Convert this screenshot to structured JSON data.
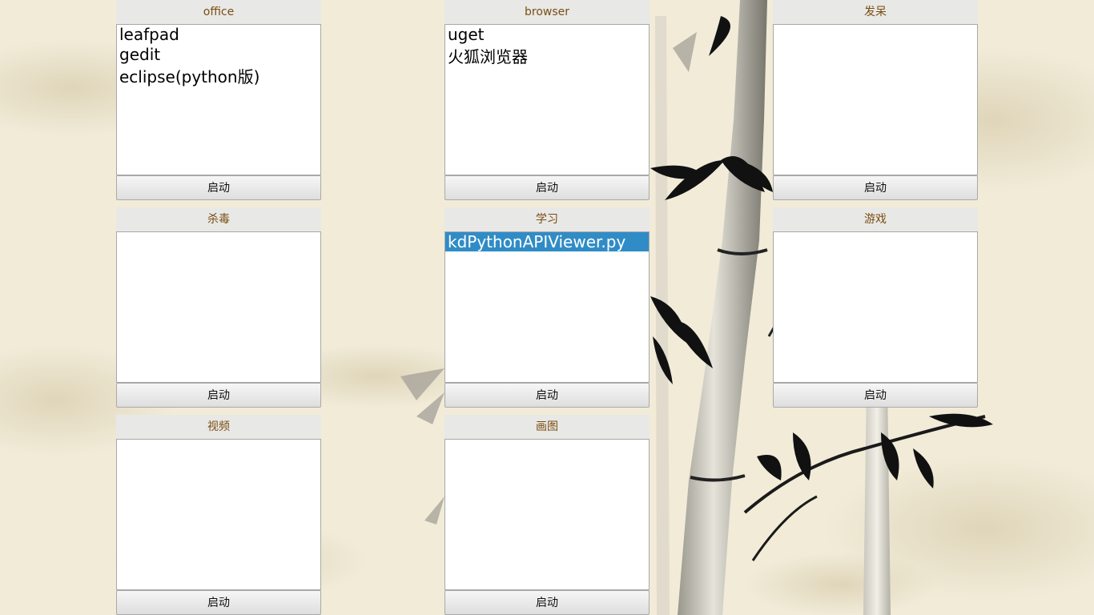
{
  "theme": {
    "background": "#f1ebd8",
    "header_text_color": "#7a4e10",
    "selection_color": "#308cc6"
  },
  "panels": [
    {
      "title": "office",
      "items": [
        "leafpad",
        "gedit",
        "eclipse(python版)"
      ],
      "selected_index": -1,
      "button_label": "启动"
    },
    {
      "title": "browser",
      "items": [
        "uget",
        "火狐浏览器"
      ],
      "selected_index": -1,
      "button_label": "启动"
    },
    {
      "title": "发呆",
      "items": [],
      "selected_index": -1,
      "button_label": "启动"
    },
    {
      "title": "杀毒",
      "items": [],
      "selected_index": -1,
      "button_label": "启动"
    },
    {
      "title": "学习",
      "items": [
        "kdPythonAPIViewer.py"
      ],
      "selected_index": 0,
      "button_label": "启动"
    },
    {
      "title": "游戏",
      "items": [],
      "selected_index": -1,
      "button_label": "启动"
    },
    {
      "title": "视频",
      "items": [],
      "selected_index": -1,
      "button_label": "启动"
    },
    {
      "title": "画图",
      "items": [],
      "selected_index": -1,
      "button_label": "启动"
    }
  ],
  "wallpaper": {
    "icon": "bamboo-ink-painting"
  }
}
